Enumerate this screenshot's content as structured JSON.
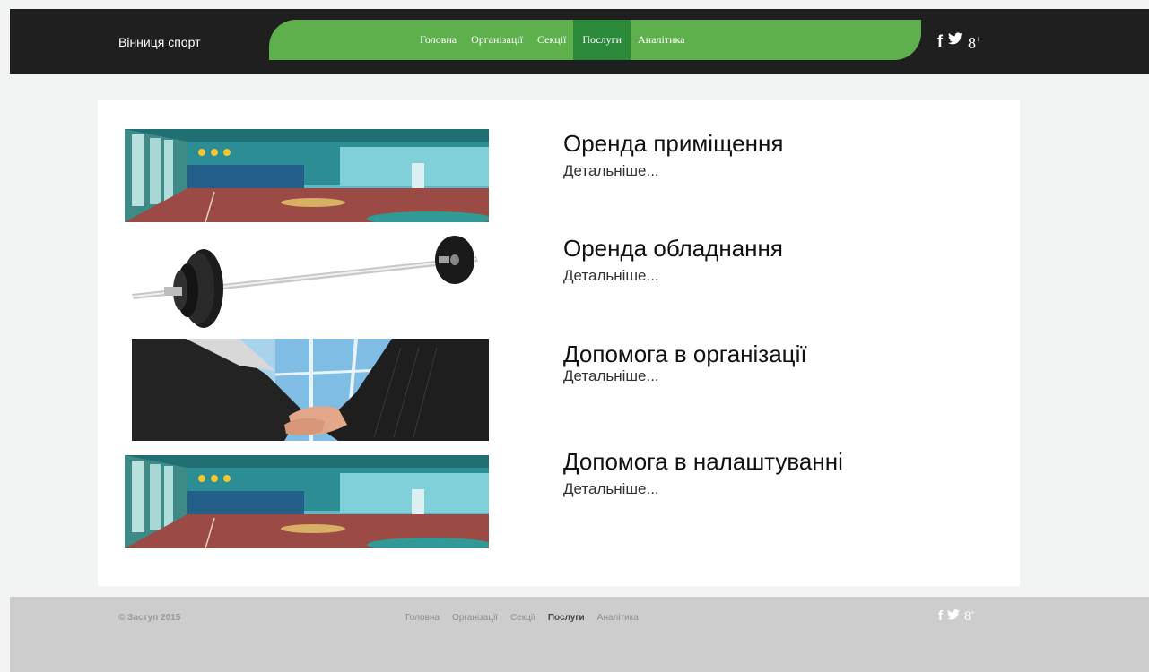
{
  "header": {
    "brand": "Вінниця спорт",
    "nav": [
      {
        "label": "Головна",
        "active": false
      },
      {
        "label": "Організації",
        "active": false
      },
      {
        "label": "Секції",
        "active": false
      },
      {
        "label": "Послуги",
        "active": true
      },
      {
        "label": "Аналітика",
        "active": false
      }
    ],
    "social": [
      "facebook-icon",
      "twitter-icon",
      "google-plus-icon"
    ]
  },
  "services": [
    {
      "title": "Оренда приміщення",
      "link": "Детальніше...",
      "image": "sports-hall"
    },
    {
      "title": "Оренда обладнання",
      "link": "Детальніше...",
      "image": "barbell"
    },
    {
      "title": "Допомога в організації",
      "link": "Детальніше...",
      "image": "handshake"
    },
    {
      "title": "Допомога в налаштуванні",
      "link": "Детальніше...",
      "image": "sports-hall"
    }
  ],
  "footer": {
    "copyright": "© Заступ 2015",
    "nav": [
      {
        "label": "Головна",
        "active": false
      },
      {
        "label": "Організації",
        "active": false
      },
      {
        "label": "Секції",
        "active": false
      },
      {
        "label": "Послуги",
        "active": true
      },
      {
        "label": "Аналітика",
        "active": false
      }
    ]
  },
  "colors": {
    "header_bg": "#1f1f1f",
    "nav_green": "#5db04c",
    "nav_active": "#2a8a3a",
    "footer_bg": "#cdcdcd"
  }
}
